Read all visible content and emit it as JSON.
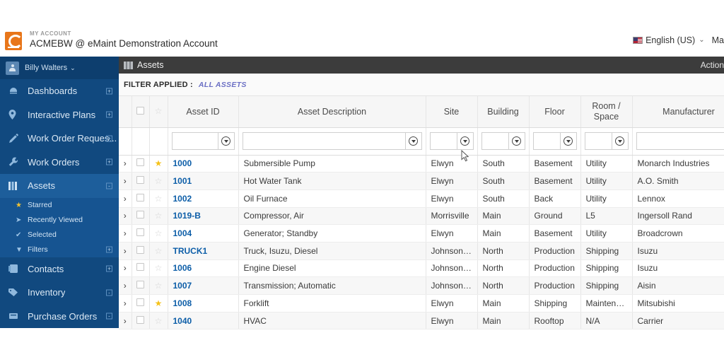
{
  "account": {
    "kicker": "MY ACCOUNT",
    "title": "ACMEBW @ eMaint Demonstration Account",
    "logo_color": "#e8761a",
    "language": "English (US)",
    "caret": "⌄",
    "right_truncated": "Ma"
  },
  "sidebar": {
    "bg_color": "#11497f",
    "active_bg_color": "#1d5e9b",
    "user": {
      "name": "Billy Walters",
      "caret": "⌄"
    },
    "items": [
      {
        "label": "Dashboards",
        "icon": "dashboard-icon",
        "expand": "+",
        "active": false
      },
      {
        "label": "Interactive Plans",
        "icon": "location-pin-icon",
        "expand": "+",
        "active": false
      },
      {
        "label": "Work Order Reques...",
        "icon": "pencil-icon",
        "expand": "+",
        "active": false
      },
      {
        "label": "Work Orders",
        "icon": "wrench-icon",
        "expand": "+",
        "active": false
      },
      {
        "label": "Assets",
        "icon": "assets-columns-icon",
        "expand": "-",
        "active": true
      }
    ],
    "sub_items": [
      {
        "label": "Starred",
        "icon": "star-icon",
        "expand": ""
      },
      {
        "label": "Recently Viewed",
        "icon": "paper-plane-icon",
        "expand": ""
      },
      {
        "label": "Selected",
        "icon": "check-icon",
        "expand": ""
      },
      {
        "label": "Filters",
        "icon": "funnel-icon",
        "expand": "+"
      }
    ],
    "items_after": [
      {
        "label": "Contacts",
        "icon": "address-book-icon",
        "expand": "+"
      },
      {
        "label": "Inventory",
        "icon": "tag-icon",
        "expand": "-"
      },
      {
        "label": "Purchase Orders",
        "icon": "cart-icon",
        "expand": "-"
      }
    ]
  },
  "page": {
    "title": "Assets",
    "icon": "assets-columns-icon",
    "actions_label": "Action",
    "filter_label": "FILTER APPLIED :",
    "filter_value": "ALL ASSETS",
    "link_color": "#6b6fc4"
  },
  "table": {
    "columns": [
      {
        "key": "expand",
        "label": ""
      },
      {
        "key": "check",
        "label": ""
      },
      {
        "key": "star",
        "label": ""
      },
      {
        "key": "asset_id",
        "label": "Asset ID"
      },
      {
        "key": "description",
        "label": "Asset Description"
      },
      {
        "key": "site",
        "label": "Site"
      },
      {
        "key": "building",
        "label": "Building"
      },
      {
        "key": "floor",
        "label": "Floor"
      },
      {
        "key": "room",
        "label": "Room / Space"
      },
      {
        "key": "manufacturer",
        "label": "Manufacturer"
      }
    ],
    "filter_inputs": {
      "asset_id": "",
      "description": "",
      "site": "",
      "building": "",
      "floor": "",
      "room": "",
      "manufacturer": ""
    },
    "rows": [
      {
        "expand": "›",
        "starred": true,
        "asset_id": "1000",
        "description": "Submersible Pump",
        "site": "Elwyn",
        "building": "South",
        "floor": "Basement",
        "room": "Utility",
        "manufacturer": "Monarch Industries"
      },
      {
        "expand": "›",
        "starred": false,
        "asset_id": "1001",
        "description": "Hot Water Tank",
        "site": "Elwyn",
        "building": "South",
        "floor": "Basement",
        "room": "Utility",
        "manufacturer": "A.O. Smith"
      },
      {
        "expand": "›",
        "starred": false,
        "asset_id": "1002",
        "description": "Oil Furnace",
        "site": "Elwyn",
        "building": "South",
        "floor": "Back",
        "room": "Utility",
        "manufacturer": "Lennox"
      },
      {
        "expand": "›",
        "starred": false,
        "asset_id": "1019-B",
        "description": "Compressor, Air",
        "site": "Morrisville",
        "building": "Main",
        "floor": "Ground",
        "room": "L5",
        "manufacturer": "Ingersoll Rand"
      },
      {
        "expand": "›",
        "starred": false,
        "asset_id": "1004",
        "description": "Generator; Standby",
        "site": "Elwyn",
        "building": "Main",
        "floor": "Basement",
        "room": "Utility",
        "manufacturer": "Broadcrown"
      },
      {
        "expand": "›",
        "starred": false,
        "asset_id": "TRUCK1",
        "description": "Truck, Isuzu, Diesel",
        "site": "Johnson C...",
        "building": "North",
        "floor": "Production",
        "room": "Shipping",
        "manufacturer": "Isuzu"
      },
      {
        "expand": "›",
        "starred": false,
        "asset_id": "1006",
        "description": "Engine Diesel",
        "site": "Johnson C...",
        "building": "North",
        "floor": "Production",
        "room": "Shipping",
        "manufacturer": "Isuzu"
      },
      {
        "expand": "›",
        "starred": false,
        "asset_id": "1007",
        "description": "Transmission; Automatic",
        "site": "Johnson C...",
        "building": "North",
        "floor": "Production",
        "room": "Shipping",
        "manufacturer": "Aisin"
      },
      {
        "expand": "›",
        "starred": true,
        "asset_id": "1008",
        "description": "Forklift",
        "site": "Elwyn",
        "building": "Main",
        "floor": "Shipping",
        "room": "Maintena...",
        "manufacturer": "Mitsubishi"
      },
      {
        "expand": "›",
        "starred": false,
        "asset_id": "1040",
        "description": "HVAC",
        "site": "Elwyn",
        "building": "Main",
        "floor": "Rooftop",
        "room": "N/A",
        "manufacturer": "Carrier"
      }
    ]
  }
}
